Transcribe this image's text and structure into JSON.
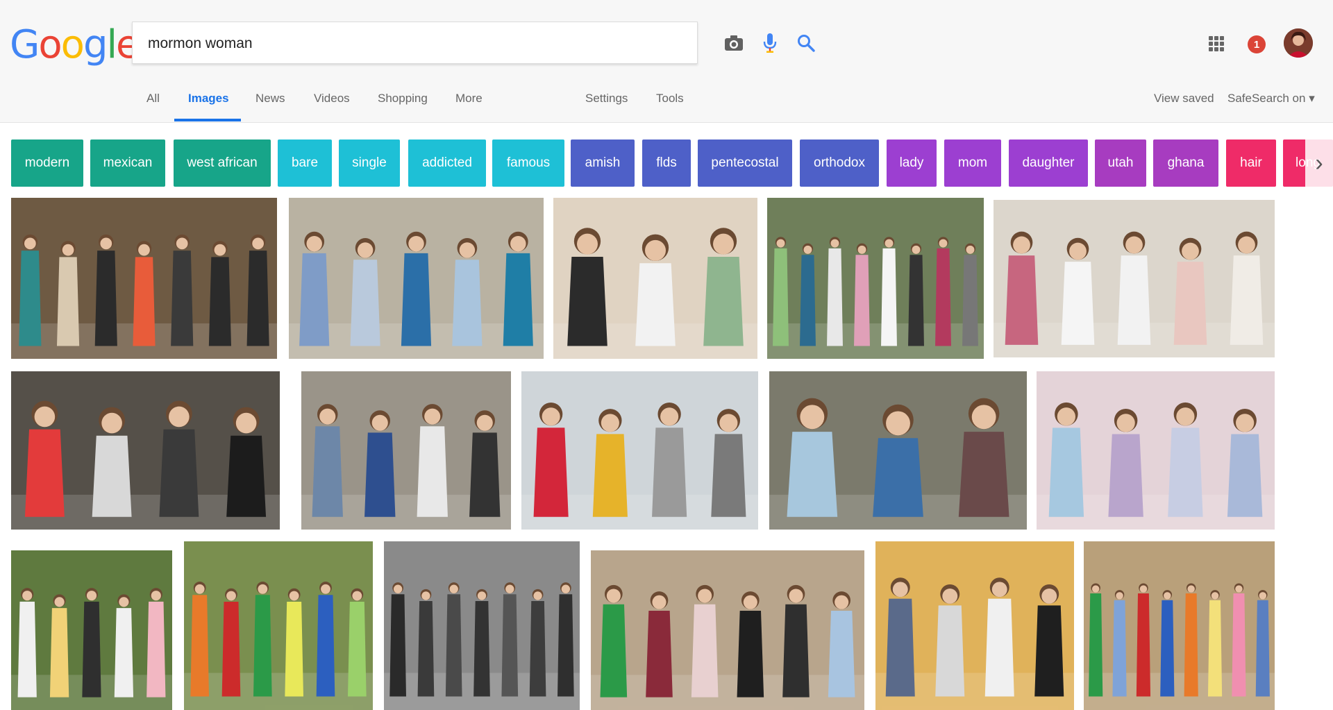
{
  "header": {
    "logo_letters": [
      {
        "ch": "G",
        "color": "#4285f4"
      },
      {
        "ch": "o",
        "color": "#ea4335"
      },
      {
        "ch": "o",
        "color": "#fbbc05"
      },
      {
        "ch": "g",
        "color": "#4285f4"
      },
      {
        "ch": "l",
        "color": "#34a853"
      },
      {
        "ch": "e",
        "color": "#ea4335"
      }
    ],
    "search_query": "mormon woman",
    "notification_count": "1"
  },
  "nav": {
    "tabs": [
      "All",
      "Images",
      "News",
      "Videos",
      "Shopping",
      "More",
      "Settings",
      "Tools"
    ],
    "active": "Images",
    "view_saved": "View saved",
    "safesearch": "SafeSearch on ▾"
  },
  "chips": [
    {
      "label": "modern",
      "color": "#17a589"
    },
    {
      "label": "mexican",
      "color": "#17a589"
    },
    {
      "label": "west african",
      "color": "#17a589"
    },
    {
      "label": "bare",
      "color": "#1ec0d6"
    },
    {
      "label": "single",
      "color": "#1ec0d6"
    },
    {
      "label": "addicted",
      "color": "#1ec0d6"
    },
    {
      "label": "famous",
      "color": "#1ec0d6"
    },
    {
      "label": "amish",
      "color": "#4e60c8"
    },
    {
      "label": "flds",
      "color": "#4e60c8"
    },
    {
      "label": "pentecostal",
      "color": "#4e60c8"
    },
    {
      "label": "orthodox",
      "color": "#4e60c8"
    },
    {
      "label": "lady",
      "color": "#9c3fd1"
    },
    {
      "label": "mom",
      "color": "#9c3fd1"
    },
    {
      "label": "daughter",
      "color": "#9c3fd1"
    },
    {
      "label": "utah",
      "color": "#a73cc0"
    },
    {
      "label": "ghana",
      "color": "#a73cc0"
    },
    {
      "label": "hair",
      "color": "#ef2b68"
    },
    {
      "label": "long",
      "color": "#ef2b68"
    }
  ],
  "images": [
    {
      "name": "missionary-group-portrait",
      "bg": "#6e5a43",
      "people": [
        "#2e8b8b",
        "#d9c9b0",
        "#2b2b2b",
        "#e85c3a",
        "#3a3a3a",
        "#2b2b2b",
        "#2b2b2b"
      ]
    },
    {
      "name": "women-in-prairie-dresses",
      "bg": "#b9b2a2",
      "people": [
        "#7f9cc7",
        "#b9c9dc",
        "#2b6fa8",
        "#a9c4dd",
        "#1f7ea6"
      ]
    },
    {
      "name": "three-women-indoor",
      "bg": "#e0d3c2",
      "people": [
        "#2b2b2b",
        "#f2f2f2",
        "#8fb58f"
      ]
    },
    {
      "name": "young-women-group-outdoor",
      "bg": "#6f7f5a",
      "people": [
        "#8ec07a",
        "#2c6b8f",
        "#e8e8e8",
        "#e0a0b8",
        "#f5f5f5",
        "#333",
        "#b33a5e",
        "#777"
      ]
    },
    {
      "name": "women-seated-audience",
      "bg": "#dcd6cc",
      "people": [
        "#c7667f",
        "#f5f5f5",
        "#f2f2f2",
        "#e9c7c0",
        "#f0ece6"
      ]
    },
    {
      "name": "sister-missionaries-smiling",
      "bg": "#555049",
      "people": [
        "#e33b3b",
        "#d8d8d8",
        "#3a3a3a",
        "#1c1c1c"
      ]
    },
    {
      "name": "women-walking-sidewalk",
      "bg": "#9a9489",
      "people": [
        "#6d87a8",
        "#2e4f8f",
        "#e8e8e8",
        "#333"
      ]
    },
    {
      "name": "girls-walking-beach",
      "bg": "#cfd5d9",
      "people": [
        "#d3263a",
        "#e6b32a",
        "#9a9a9a",
        "#7a7a7a"
      ]
    },
    {
      "name": "missionaries-at-door",
      "bg": "#7b7a6c",
      "people": [
        "#a7c7dd",
        "#3b6fa8",
        "#6a4a4a"
      ]
    },
    {
      "name": "women-in-pastel-dresses",
      "bg": "#e4d3d8",
      "people": [
        "#a6c8e0",
        "#b9a5cc",
        "#c7cde3",
        "#a9b9d9"
      ]
    },
    {
      "name": "sister-missionaries-park",
      "bg": "#5f7a3f",
      "people": [
        "#f0f0f0",
        "#f1d277",
        "#2f2f2f",
        "#f0f0f0",
        "#f2b7c2"
      ]
    },
    {
      "name": "family-on-bench",
      "bg": "#7a8f4f",
      "people": [
        "#e87a2a",
        "#cc2b2b",
        "#2b9a48",
        "#e8e85a",
        "#2c5fbf",
        "#9ad06a"
      ]
    },
    {
      "name": "historic-women-photo",
      "bg": "#8a8a8a",
      "people": [
        "#2a2a2a",
        "#3a3a3a",
        "#4a4a4a",
        "#333",
        "#555",
        "#3d3d3d",
        "#2f2f2f"
      ]
    },
    {
      "name": "women-against-stone-wall",
      "bg": "#b8a58c",
      "people": [
        "#2b9a48",
        "#8a2a3a",
        "#e8d0d0",
        "#1f1f1f",
        "#2f2f2f",
        "#a8c4e0"
      ]
    },
    {
      "name": "family-formal-portrait",
      "bg": "#e0b25a",
      "people": [
        "#5a6a8a",
        "#d8d8d8",
        "#f0f0f0",
        "#1f1f1f"
      ]
    },
    {
      "name": "large-family-outdoor",
      "bg": "#b9a07a",
      "people": [
        "#2b9a48",
        "#7fa3d8",
        "#cc2b2b",
        "#2c5fbf",
        "#e87a2a",
        "#f3e07a",
        "#f08fb0",
        "#5a7fc0"
      ]
    }
  ]
}
